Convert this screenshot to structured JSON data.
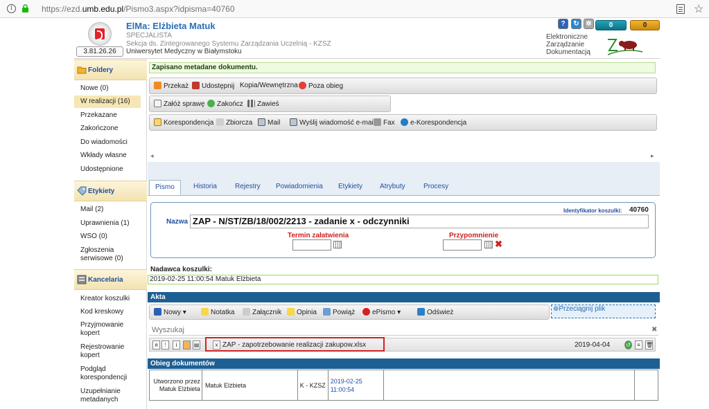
{
  "browser": {
    "url_prefix": "https://ezd.",
    "url_host": "umb.edu.pl",
    "url_path": "/Pismo3.aspx?idpisma=40760"
  },
  "header": {
    "version": "3.81.26.26",
    "app_title": "ElMa: Elżbieta Matuk",
    "role": "SPECJALISTA",
    "unit": "Sekcja ds. Zintegrowanego Systemu Zarządzania Uczelnią - KZSZ",
    "university": "Uniwersytet Medyczny w Białymstoku",
    "ezd_line1": "Elektroniczne",
    "ezd_line2": "Zarządzanie",
    "ezd_line3": "Dokumentacją",
    "counter1": "0",
    "counter2": "0"
  },
  "sidebar": {
    "folders_title": "Foldery",
    "folders": [
      "Nowe (0)",
      "W realizacji (16)",
      "Przekazane",
      "Zakończone",
      "Do wiadomości",
      "Wkłady własne",
      "Udostępnione"
    ],
    "labels_title": "Etykiety",
    "labels": [
      "Mail (2)",
      "Uprawnienia (1)",
      "WSO (0)",
      "Zgłoszenia serwisowe (0)"
    ],
    "office_title": "Kancelaria",
    "office": [
      "Kreator koszulki",
      "Kod kreskowy",
      "Przyjmowanie kopert",
      "Rejestrowanie kopert",
      "Podgląd korespondencji",
      "Uzupełnianie metadanych"
    ]
  },
  "message": "Zapisano metadane dokumentu.",
  "toolbar1": [
    "Przekaż",
    "Udostępnij",
    "Kopia/Wewnętrzna",
    "Poza obieg"
  ],
  "toolbar2": [
    "Załóż sprawę",
    "Zakończ",
    "Zawieś"
  ],
  "toolbar3": [
    "Korespondencja",
    "Zbiorcza",
    "Mail",
    "Wyślij wiadomość e-mail",
    "Fax",
    "e-Korespondencja"
  ],
  "tabs": [
    "Pismo",
    "Historia",
    "Rejestry",
    "Powiadomienia",
    "Etykiety",
    "Atrybuty",
    "Procesy"
  ],
  "form": {
    "id_label": "Identyfikator koszulki:",
    "id_value": "40760",
    "name_label": "Nazwa",
    "name_value": "ZAP - N/ST/ZB/18/002/2213 - zadanie x - odczynniki",
    "term_label": "Termin załatwienia",
    "reminder_label": "Przypomnienie"
  },
  "sender": {
    "label": "Nadawca koszulki:",
    "value": "2019-02-25 11:00:54  Matuk Elżbieta"
  },
  "akta": {
    "title": "Akta",
    "toolbar": [
      "Nowy",
      "Notatka",
      "Załącznik",
      "Opinia",
      "Powiąż",
      "ePismo",
      "Odśwież"
    ],
    "drag_label": "Przeciągnij plik",
    "search_placeholder": "Wyszukaj",
    "file_name": "ZAP - zapotrzebowanie realizacji zakupow.xlsx",
    "file_date": "2019-04-04"
  },
  "flow": {
    "title": "Obieg dokumentów",
    "created_label": "Utworzono przez Matuk Elżbieta",
    "person": "Matuk Elżbieta",
    "unit": "K - KZSZ",
    "date": "2019-02-25",
    "time": "11:00:54"
  },
  "colors": {
    "accent": "#1d5f93",
    "section_bg": "#f3e3b0",
    "highlight": "#d32020"
  }
}
